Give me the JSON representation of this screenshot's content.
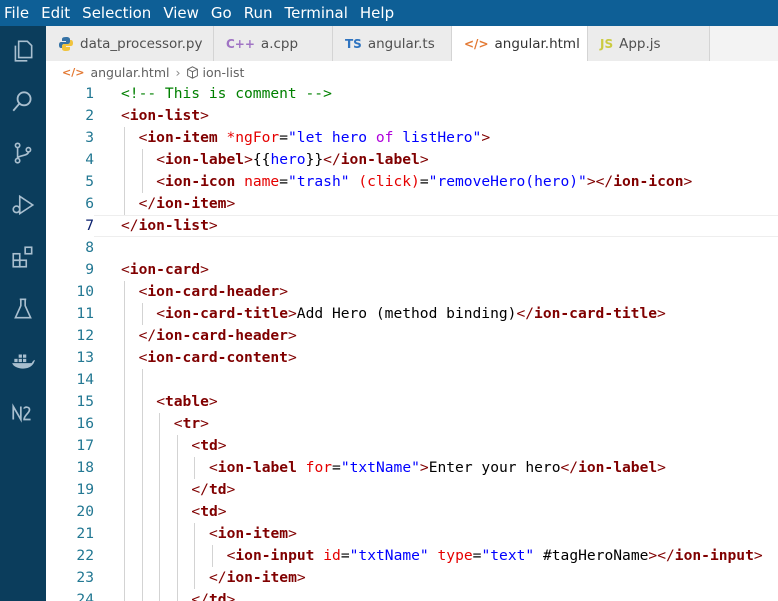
{
  "menu": [
    "File",
    "Edit",
    "Selection",
    "View",
    "Go",
    "Run",
    "Terminal",
    "Help"
  ],
  "tabs": [
    {
      "label": "data_processor.py",
      "icon": "python-icon",
      "active": false
    },
    {
      "label": "a.cpp",
      "icon": "cpp-icon",
      "active": false
    },
    {
      "label": "angular.ts",
      "icon": "ts-icon",
      "active": false
    },
    {
      "label": "angular.html",
      "icon": "html-icon",
      "active": true
    },
    {
      "label": "App.js",
      "icon": "js-icon",
      "active": false
    }
  ],
  "breadcrumb": {
    "file": "angular.html",
    "symbol": "ion-list"
  },
  "active_line": 7,
  "colors": {
    "menubar": "#0e5f96",
    "activitybar": "#0b3d5c",
    "tag": "#800000",
    "attr": "#e50000",
    "string": "#0000ff",
    "comment": "#008000"
  },
  "activity_icons": [
    "explorer-icon",
    "search-icon",
    "source-control-icon",
    "run-debug-icon",
    "extensions-icon",
    "testing-icon",
    "docker-icon",
    "notebook-icon"
  ],
  "lines": [
    {
      "n": "1",
      "indent": 1,
      "tokens": [
        [
          "c",
          "<!-- This is comment -->"
        ]
      ]
    },
    {
      "n": "2",
      "indent": 1,
      "tokens": [
        [
          "p",
          "<"
        ],
        [
          "t",
          "ion-list"
        ],
        [
          "p",
          ">"
        ]
      ]
    },
    {
      "n": "3",
      "indent": 2,
      "tokens": [
        [
          "p",
          "<"
        ],
        [
          "t",
          "ion-item"
        ],
        [
          "x",
          " "
        ],
        [
          "a",
          "*ngFor"
        ],
        [
          "x",
          "="
        ],
        [
          "s",
          "\"let hero "
        ],
        [
          "k",
          "of"
        ],
        [
          "s",
          " listHero\""
        ],
        [
          "p",
          ">"
        ]
      ]
    },
    {
      "n": "4",
      "indent": 3,
      "tokens": [
        [
          "p",
          "<"
        ],
        [
          "t",
          "ion-label"
        ],
        [
          "p",
          ">"
        ],
        [
          "x",
          "{{"
        ],
        [
          "s",
          "hero"
        ],
        [
          "x",
          "}}"
        ],
        [
          "p",
          "</"
        ],
        [
          "t",
          "ion-label"
        ],
        [
          "p",
          ">"
        ]
      ]
    },
    {
      "n": "5",
      "indent": 3,
      "tokens": [
        [
          "p",
          "<"
        ],
        [
          "t",
          "ion-icon"
        ],
        [
          "x",
          " "
        ],
        [
          "a",
          "name"
        ],
        [
          "x",
          "="
        ],
        [
          "s",
          "\"trash\""
        ],
        [
          "x",
          " "
        ],
        [
          "a",
          "(click)"
        ],
        [
          "x",
          "="
        ],
        [
          "s",
          "\"removeHero(hero)\""
        ],
        [
          "p",
          ">"
        ],
        [
          "p",
          "</"
        ],
        [
          "t",
          "ion-icon"
        ],
        [
          "p",
          ">"
        ]
      ]
    },
    {
      "n": "6",
      "indent": 2,
      "tokens": [
        [
          "p",
          "</"
        ],
        [
          "t",
          "ion-item"
        ],
        [
          "p",
          ">"
        ]
      ]
    },
    {
      "n": "7",
      "indent": 1,
      "tokens": [
        [
          "p",
          "</"
        ],
        [
          "t",
          "ion-list"
        ],
        [
          "p",
          ">"
        ]
      ]
    },
    {
      "n": "8",
      "indent": 0,
      "tokens": []
    },
    {
      "n": "9",
      "indent": 1,
      "tokens": [
        [
          "p",
          "<"
        ],
        [
          "t",
          "ion-card"
        ],
        [
          "p",
          ">"
        ]
      ]
    },
    {
      "n": "10",
      "indent": 2,
      "tokens": [
        [
          "p",
          "<"
        ],
        [
          "t",
          "ion-card-header"
        ],
        [
          "p",
          ">"
        ]
      ]
    },
    {
      "n": "11",
      "indent": 3,
      "tokens": [
        [
          "p",
          "<"
        ],
        [
          "t",
          "ion-card-title"
        ],
        [
          "p",
          ">"
        ],
        [
          "x",
          "Add Hero (method binding)"
        ],
        [
          "p",
          "</"
        ],
        [
          "t",
          "ion-card-title"
        ],
        [
          "p",
          ">"
        ]
      ]
    },
    {
      "n": "12",
      "indent": 2,
      "tokens": [
        [
          "p",
          "</"
        ],
        [
          "t",
          "ion-card-header"
        ],
        [
          "p",
          ">"
        ]
      ]
    },
    {
      "n": "13",
      "indent": 2,
      "tokens": [
        [
          "p",
          "<"
        ],
        [
          "t",
          "ion-card-content"
        ],
        [
          "p",
          ">"
        ]
      ]
    },
    {
      "n": "14",
      "indent": 0,
      "tokens": []
    },
    {
      "n": "15",
      "indent": 3,
      "tokens": [
        [
          "p",
          "<"
        ],
        [
          "t",
          "table"
        ],
        [
          "p",
          ">"
        ]
      ]
    },
    {
      "n": "16",
      "indent": 4,
      "tokens": [
        [
          "p",
          "<"
        ],
        [
          "t",
          "tr"
        ],
        [
          "p",
          ">"
        ]
      ]
    },
    {
      "n": "17",
      "indent": 5,
      "tokens": [
        [
          "p",
          "<"
        ],
        [
          "t",
          "td"
        ],
        [
          "p",
          ">"
        ]
      ]
    },
    {
      "n": "18",
      "indent": 6,
      "tokens": [
        [
          "p",
          "<"
        ],
        [
          "t",
          "ion-label"
        ],
        [
          "x",
          " "
        ],
        [
          "a",
          "for"
        ],
        [
          "x",
          "="
        ],
        [
          "s",
          "\"txtName\""
        ],
        [
          "p",
          ">"
        ],
        [
          "x",
          "Enter your hero"
        ],
        [
          "p",
          "</"
        ],
        [
          "t",
          "ion-label"
        ],
        [
          "p",
          ">"
        ]
      ]
    },
    {
      "n": "19",
      "indent": 5,
      "tokens": [
        [
          "p",
          "</"
        ],
        [
          "t",
          "td"
        ],
        [
          "p",
          ">"
        ]
      ]
    },
    {
      "n": "20",
      "indent": 5,
      "tokens": [
        [
          "p",
          "<"
        ],
        [
          "t",
          "td"
        ],
        [
          "p",
          ">"
        ]
      ]
    },
    {
      "n": "21",
      "indent": 6,
      "tokens": [
        [
          "p",
          "<"
        ],
        [
          "t",
          "ion-item"
        ],
        [
          "p",
          ">"
        ]
      ]
    },
    {
      "n": "22",
      "indent": 7,
      "tokens": [
        [
          "p",
          "<"
        ],
        [
          "t",
          "ion-input"
        ],
        [
          "x",
          " "
        ],
        [
          "a",
          "id"
        ],
        [
          "x",
          "="
        ],
        [
          "s",
          "\"txtName\""
        ],
        [
          "x",
          " "
        ],
        [
          "a",
          "type"
        ],
        [
          "x",
          "="
        ],
        [
          "s",
          "\"text\""
        ],
        [
          "x",
          " #tagHeroName"
        ],
        [
          "p",
          ">"
        ],
        [
          "p",
          "</"
        ],
        [
          "t",
          "ion-input"
        ],
        [
          "p",
          ">"
        ]
      ]
    },
    {
      "n": "23",
      "indent": 6,
      "tokens": [
        [
          "p",
          "</"
        ],
        [
          "t",
          "ion-item"
        ],
        [
          "p",
          ">"
        ]
      ]
    },
    {
      "n": "24",
      "indent": 5,
      "tokens": [
        [
          "p",
          "</"
        ],
        [
          "t",
          "td"
        ],
        [
          "p",
          ">"
        ]
      ]
    }
  ]
}
